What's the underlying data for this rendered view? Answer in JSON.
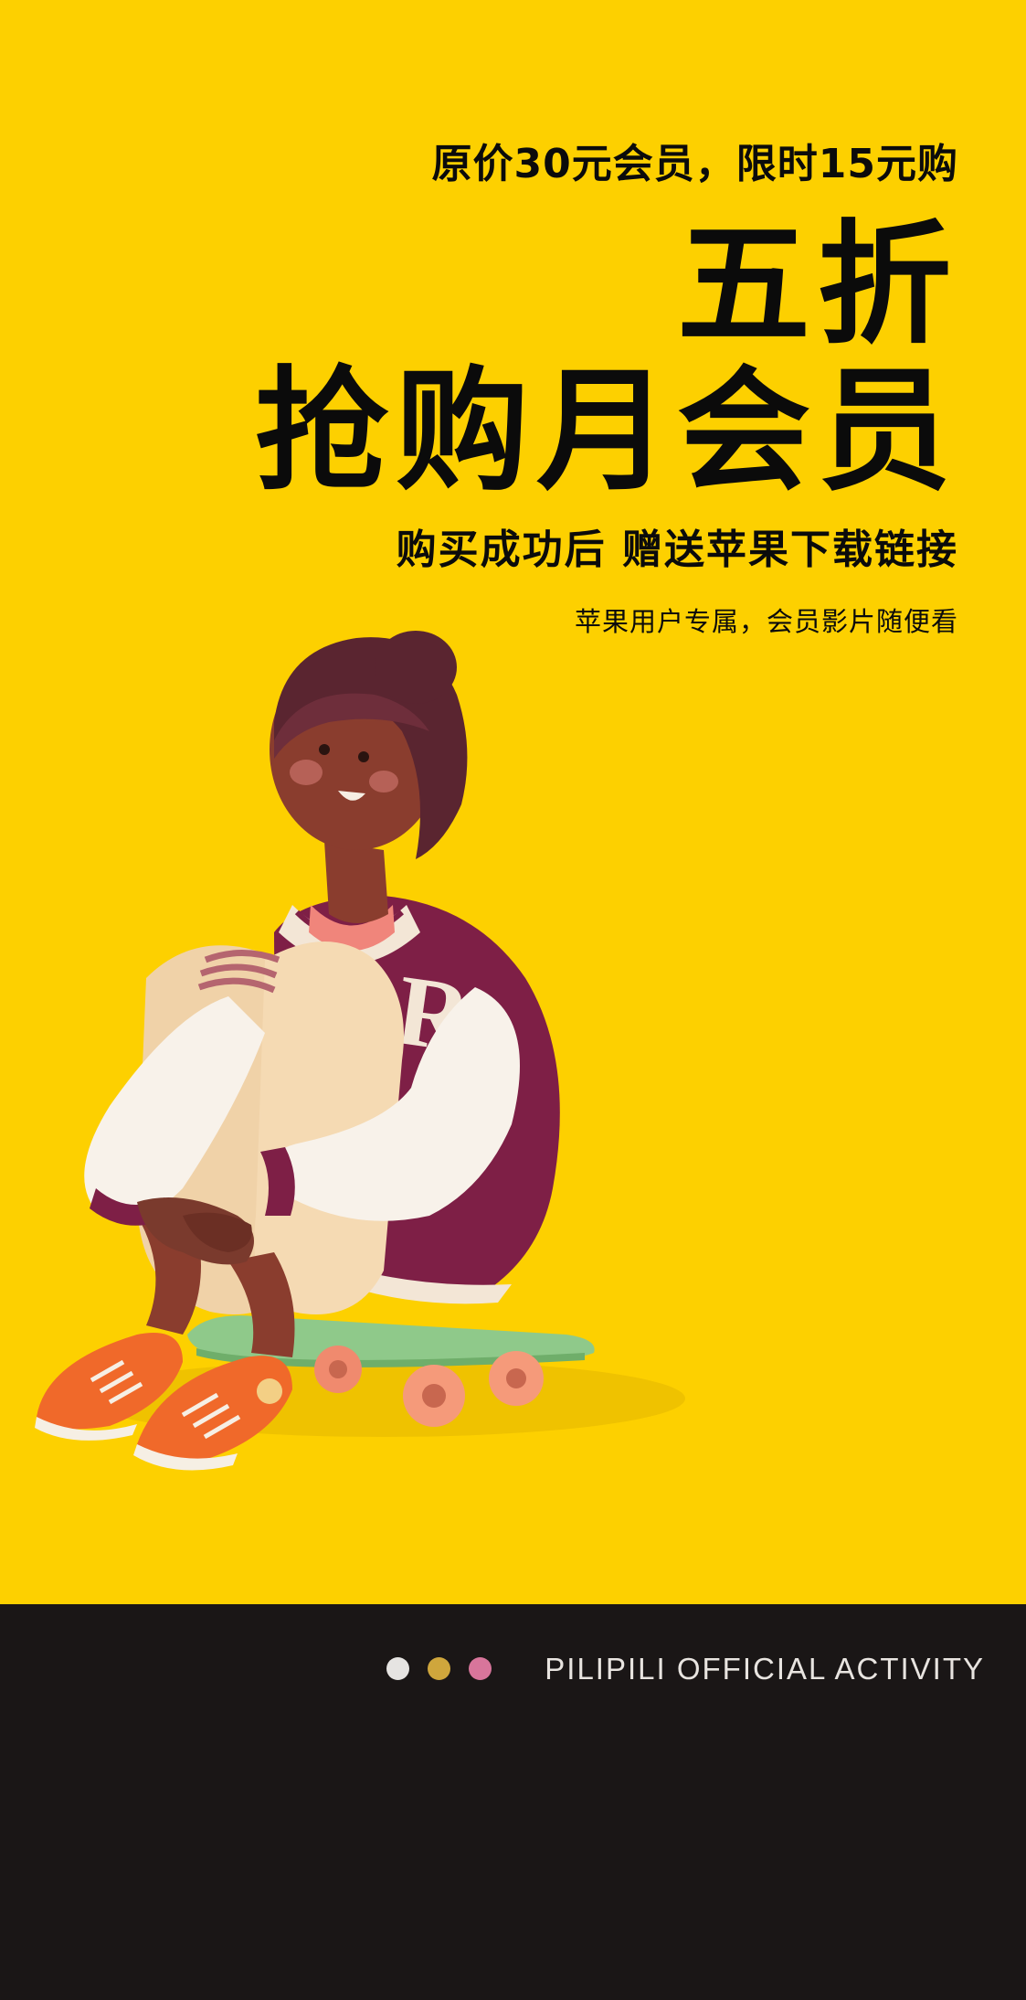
{
  "promo": {
    "pre_headline": "原价30元会员，限时15元购",
    "headline_line1": "五折",
    "headline_line2": "抢购月会员",
    "subhead": "购买成功后 赠送苹果下载链接",
    "note": "苹果用户专属，会员影片随便看"
  },
  "footer": {
    "label": "PILIPILI OFFICIAL ACTIVITY",
    "dots": [
      "#e6e4e2",
      "#cfa63c",
      "#d8759b"
    ]
  },
  "illustration": {
    "icon": "skateboard-character-illustration"
  },
  "colors": {
    "background": "#fdd000",
    "footer": "#1a1616",
    "text": "#0b0b0b"
  }
}
